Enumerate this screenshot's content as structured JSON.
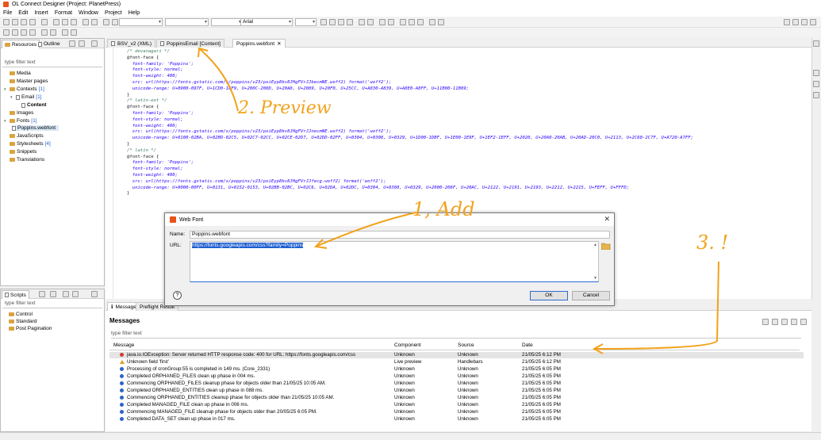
{
  "window": {
    "title": "OL Connect Designer (Project: PlanetPress)"
  },
  "menu": [
    "File",
    "Edit",
    "Insert",
    "Format",
    "Window",
    "Project",
    "Help"
  ],
  "toolbar": {
    "font_name": "Arial"
  },
  "left_panel": {
    "tabs": [
      "Resources",
      "Outline"
    ],
    "filter_placeholder": "type filter text",
    "tree": [
      {
        "label": "Media",
        "count": ""
      },
      {
        "label": "Master pages",
        "count": ""
      },
      {
        "label": "Contexts",
        "count": "[1]"
      },
      {
        "label": "Email",
        "count": "[1]"
      },
      {
        "label": "Content",
        "count": ""
      },
      {
        "label": "Images",
        "count": ""
      },
      {
        "label": "Fonts",
        "count": "[1]"
      },
      {
        "label": "Poppins.webfont",
        "count": ""
      },
      {
        "label": "JavaScripts",
        "count": ""
      },
      {
        "label": "Stylesheets",
        "count": "[4]"
      },
      {
        "label": "Snippets",
        "count": ""
      },
      {
        "label": "Translations",
        "count": ""
      }
    ]
  },
  "scripts_panel": {
    "tab": "Scripts",
    "filter_placeholder": "type filter text",
    "items": [
      "Control",
      "Standard",
      "Post Pagination"
    ]
  },
  "editor": {
    "tabs": [
      "BSV_v2 (XML)",
      "PoppinsEmail [Content]",
      "Poppins.webfont"
    ],
    "lines": [
      "/* devanagari */",
      "@font-face {",
      "  font-family: 'Poppins';",
      "  font-style: normal;",
      "  font-weight: 400;",
      "  src: url(https://fonts.gstatic.com/s/poppins/v23/pxiEyp8kv8JHgFVrJJbecmNE.woff2) format('woff2');",
      "  unicode-range: U+0900-097F, U+1CD0-1CF9, U+200C-200D, U+20A8, U+2089, U+20F0, U+25CC, U+A830-A839, U+A8E0-A8FF, U+11B00-11B09;",
      "}",
      "/* latin-ext */",
      "@font-face {",
      "  font-family: 'Poppins';",
      "  font-style: normal;",
      "  font-weight: 400;",
      "  src: url(https://fonts.gstatic.com/s/poppins/v23/pxiEyp8kv8JHgFVrJJnecmNE.woff2) format('woff2');",
      "  unicode-range: U+0100-02BA, U+02BD-02C5, U+02C7-02CC, U+02CE-02D7, U+02DD-02FF, U+0304, U+0308, U+0329, U+1D00-1DBF, U+1E00-1E9F, U+1EF2-1EFF, U+2020, U+20A0-20AB, U+20AD-20C0, U+2113, U+2C60-2C7F, U+A720-A7FF;",
      "}",
      "/* latin */",
      "@font-face {",
      "  font-family: 'Poppins';",
      "  font-style: normal;",
      "  font-weight: 400;",
      "  src: url(https://fonts.gstatic.com/s/poppins/v23/pxiEyp8kv8JHgFVrJJfecg.woff2) format('woff2');",
      "  unicode-range: U+0000-00FF, U+0131, U+0152-0153, U+02BB-02BC, U+02C6, U+02DA, U+02DC, U+0304, U+0308, U+0329, U+2000-206F, U+20AC, U+2122, U+2191, U+2193, U+2212, U+2215, U+FEFF, U+FFFD;",
      "}"
    ]
  },
  "dialog": {
    "title": "Web Font",
    "name_label": "Name:",
    "name_value": "Poppins.webfont",
    "url_label": "URL:",
    "url_value": "https://fonts.googleapis.com/css?family=Poppins",
    "ok_label": "OK",
    "cancel_label": "Cancel"
  },
  "messages": {
    "tabs": [
      "Messages",
      "Preflight Result"
    ],
    "title": "Messages",
    "filter_placeholder": "type filter text",
    "columns": [
      "Message",
      "Component",
      "Source",
      "Date"
    ],
    "rows": [
      {
        "type": "error",
        "message": "java.io.IOException: Server returned HTTP response code: 400 for URL: https://fonts.googleapis.com/css",
        "component": "Unknown",
        "source": "Unknown",
        "date": "21/05/25 6:12 PM"
      },
      {
        "type": "warning",
        "message": "Unknown field 'first'",
        "component": "Live preview",
        "source": "Handlebars",
        "date": "21/05/25 6:12 PM"
      },
      {
        "type": "info",
        "message": "Processing of cronGroup:55 is completed in 149 ms. (Core_2331)",
        "component": "Unknown",
        "source": "Unknown",
        "date": "21/05/25 6:05 PM"
      },
      {
        "type": "info",
        "message": "Completed ORPHANED_FILES clean up phase in 004 ms.",
        "component": "Unknown",
        "source": "Unknown",
        "date": "21/05/25 6:05 PM"
      },
      {
        "type": "info",
        "message": "Commencing ORPHANED_FILES cleanup phase for objects older than 21/05/25 10:05 AM.",
        "component": "Unknown",
        "source": "Unknown",
        "date": "21/05/25 6:05 PM"
      },
      {
        "type": "info",
        "message": "Completed ORPHANED_ENTITIES clean up phase in 088 ms.",
        "component": "Unknown",
        "source": "Unknown",
        "date": "21/05/25 6:05 PM"
      },
      {
        "type": "info",
        "message": "Commencing ORPHANED_ENTITIES cleanup phase for objects older than 21/05/25 10:05 AM.",
        "component": "Unknown",
        "source": "Unknown",
        "date": "21/05/25 6:05 PM"
      },
      {
        "type": "info",
        "message": "Completed MANAGED_FILE clean up phase in 006 ms.",
        "component": "Unknown",
        "source": "Unknown",
        "date": "21/05/25 6:05 PM"
      },
      {
        "type": "info",
        "message": "Commencing MANAGED_FILE cleanup phase for objects older than 20/05/25 6:05 PM.",
        "component": "Unknown",
        "source": "Unknown",
        "date": "21/05/25 6:05 PM"
      },
      {
        "type": "info",
        "message": "Completed DATA_SET clean up phase in 017 ms.",
        "component": "Unknown",
        "source": "Unknown",
        "date": "21/05/25 6:05 PM"
      }
    ]
  },
  "annotations": {
    "step1": "1, Add",
    "step2": "2. Preview",
    "step3": "3. !",
    "color": "#f2a21b"
  }
}
